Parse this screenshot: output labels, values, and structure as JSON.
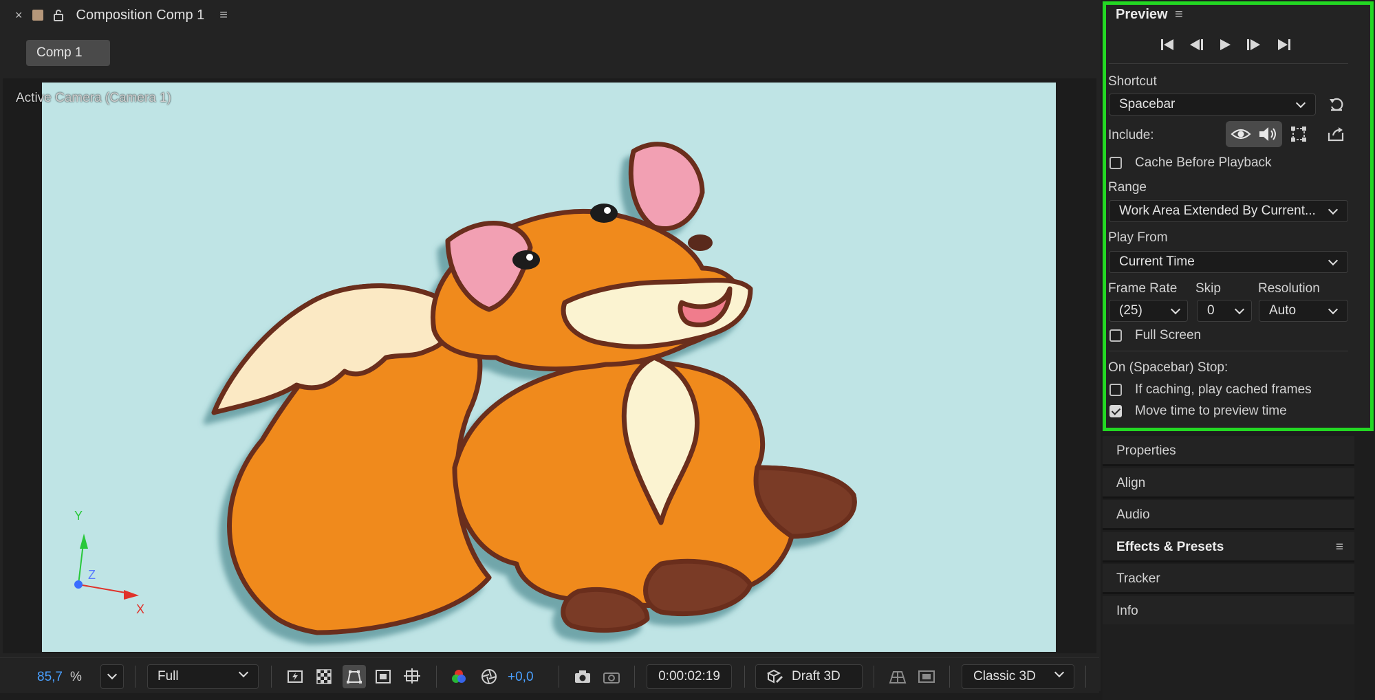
{
  "composition": {
    "panel_title": "Composition Comp 1",
    "tab_label": "Comp 1",
    "camera_label": "Active Camera (Camera 1)",
    "axis_labels": {
      "y": "Y",
      "z": "Z",
      "x": "X"
    },
    "colors": {
      "canvas_bg": "#bfe4e5",
      "accent_blue": "#4aa0ff"
    }
  },
  "toolbar": {
    "zoom_value": "85,7",
    "zoom_unit": "%",
    "resolution": "Full",
    "exposure": "+0,0",
    "timecode": "0:00:02:19",
    "renderer_label": "Draft 3D",
    "view_mode": "Classic 3D"
  },
  "preview": {
    "title": "Preview",
    "shortcut_label": "Shortcut",
    "shortcut_value": "Spacebar",
    "include_label": "Include:",
    "cache_before_playback": {
      "label": "Cache Before Playback",
      "checked": false
    },
    "range_label": "Range",
    "range_value": "Work Area Extended By Current...",
    "play_from_label": "Play From",
    "play_from_value": "Current Time",
    "frame_rate_label": "Frame Rate",
    "frame_rate_value": "(25)",
    "skip_label": "Skip",
    "skip_value": "0",
    "resolution_label": "Resolution",
    "resolution_value": "Auto",
    "full_screen": {
      "label": "Full Screen",
      "checked": false
    },
    "on_stop_label": "On (Spacebar) Stop:",
    "if_caching": {
      "label": "If caching, play cached frames",
      "checked": false
    },
    "move_time": {
      "label": "Move time to preview time",
      "checked": true
    },
    "highlight_color": "#23d823"
  },
  "side_panels": [
    {
      "label": "Properties"
    },
    {
      "label": "Align"
    },
    {
      "label": "Audio"
    },
    {
      "label": "Effects & Presets"
    },
    {
      "label": "Tracker"
    },
    {
      "label": "Info"
    }
  ]
}
